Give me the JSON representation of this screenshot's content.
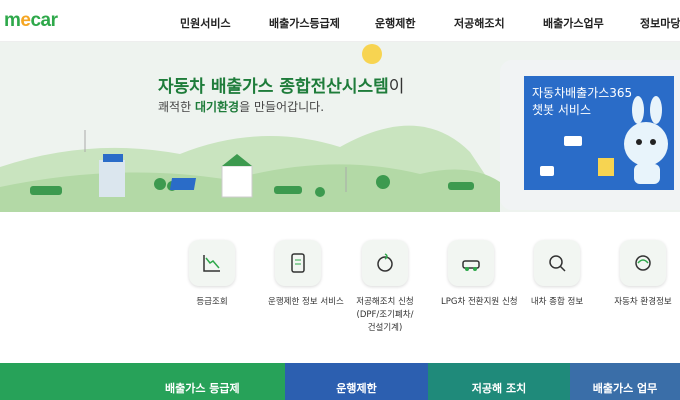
{
  "brand": {
    "logo_m": "m",
    "logo_e": "e",
    "logo_car": "car"
  },
  "nav": [
    "민원서비스",
    "배출가스등급제",
    "운행제한",
    "저공해조치",
    "배출가스업무",
    "정보마당"
  ],
  "hero": {
    "title_main": "자동차 배출가스 종합전산시스템",
    "title_suffix": "이",
    "subtitle_pre": "쾌적한 ",
    "subtitle_bold": "대기환경",
    "subtitle_post": "을 만들어갑니다."
  },
  "chatbot": {
    "line1": "자동차배출가스365",
    "line2": "챗봇 서비스"
  },
  "quick_menu": [
    {
      "label": "등급조회",
      "icon": "chart-icon"
    },
    {
      "label": "운행제한 정보 서비스",
      "icon": "document-icon"
    },
    {
      "label": "저공해조치 신청\n(DPF/조기폐차/\n건설기계)",
      "icon": "globe-icon"
    },
    {
      "label": "LPG차 전환지원 신청",
      "icon": "car-icon"
    },
    {
      "label": "내차 종합 정보",
      "icon": "magnifier-car-icon"
    },
    {
      "label": "자동차 환경정보",
      "icon": "leaf-globe-icon"
    }
  ],
  "bottom_tabs": [
    {
      "label": "배출가스 등급제",
      "color": "#27a259"
    },
    {
      "label": "운행제한",
      "color": "#2c5fb0"
    },
    {
      "label": "저공해 조치",
      "color": "#1f8a7a"
    },
    {
      "label": "배출가스 업무",
      "color": "#3a6ea8"
    }
  ]
}
